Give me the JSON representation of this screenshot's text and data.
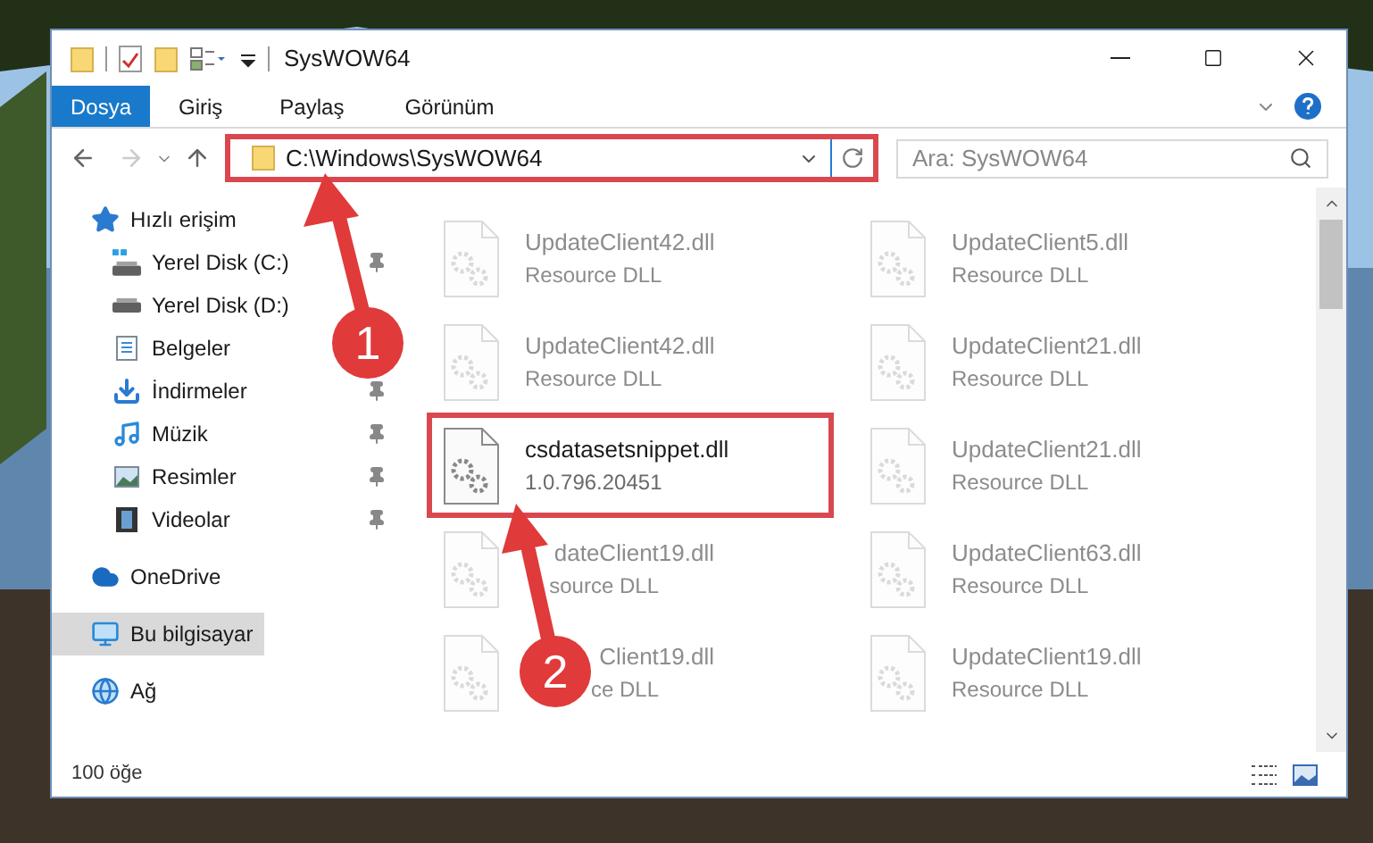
{
  "window": {
    "title": "SysWOW64"
  },
  "ribbon_tabs": [
    {
      "label": "Dosya",
      "selected": true
    },
    {
      "label": "Giriş",
      "selected": false
    },
    {
      "label": "Paylaş",
      "selected": false
    },
    {
      "label": "Görünüm",
      "selected": false
    }
  ],
  "address": {
    "path": "C:\\Windows\\SysWOW64",
    "highlighted": true
  },
  "search": {
    "placeholder": "Ara: SysWOW64"
  },
  "navigation": [
    {
      "label": "Hızlı erişim",
      "kind": "star",
      "selected": false,
      "children": [
        {
          "label": "Yerel Disk (C:)",
          "kind": "drive-win",
          "pinned": true,
          "selected": false
        },
        {
          "label": "Yerel Disk (D:)",
          "kind": "drive",
          "pinned": false,
          "selected": false
        },
        {
          "label": "Belgeler",
          "kind": "docs",
          "pinned": false,
          "selected": false
        },
        {
          "label": "İndirmeler",
          "kind": "download",
          "pinned": true,
          "selected": false
        },
        {
          "label": "Müzik",
          "kind": "music",
          "pinned": true,
          "selected": false
        },
        {
          "label": "Resimler",
          "kind": "pictures",
          "pinned": true,
          "selected": false
        },
        {
          "label": "Videolar",
          "kind": "videos",
          "pinned": true,
          "selected": false
        }
      ]
    },
    {
      "label": "OneDrive",
      "kind": "cloud",
      "selected": false
    },
    {
      "label": "Bu bilgisayar",
      "kind": "computer",
      "selected": true
    },
    {
      "label": "Ağ",
      "kind": "network",
      "selected": false
    }
  ],
  "files": [
    {
      "name": "UpdateClient42.dll",
      "detail": "Resource DLL",
      "faded": true,
      "highlighted": false,
      "clipped": false
    },
    {
      "name": "UpdateClient5.dll",
      "detail": "Resource DLL",
      "faded": true,
      "highlighted": false,
      "clipped": false
    },
    {
      "name": "UpdateClient42.dll",
      "detail": "Resource DLL",
      "faded": true,
      "highlighted": false,
      "clipped": false
    },
    {
      "name": "UpdateClient21.dll",
      "detail": "Resource DLL",
      "faded": true,
      "highlighted": false,
      "clipped": false
    },
    {
      "name": "csdatasetsnippet.dll",
      "detail": "1.0.796.20451",
      "faded": false,
      "highlighted": true,
      "clipped": false
    },
    {
      "name": "UpdateClient21.dll",
      "detail": "Resource DLL",
      "faded": true,
      "highlighted": false,
      "clipped": false
    },
    {
      "name": "dateClient19.dll",
      "detail": "source DLL",
      "faded": true,
      "highlighted": false,
      "clipped": true
    },
    {
      "name": "UpdateClient63.dll",
      "detail": "Resource DLL",
      "faded": true,
      "highlighted": false,
      "clipped": false
    },
    {
      "name": "Client19.dll",
      "detail": "ce DLL",
      "faded": true,
      "highlighted": false,
      "clipped": true
    },
    {
      "name": "UpdateClient19.dll",
      "detail": "Resource DLL",
      "faded": true,
      "highlighted": false,
      "clipped": false
    }
  ],
  "status_bar": {
    "item_count": "100 öğe"
  },
  "annotations": [
    {
      "number": "1"
    },
    {
      "number": "2"
    }
  ]
}
